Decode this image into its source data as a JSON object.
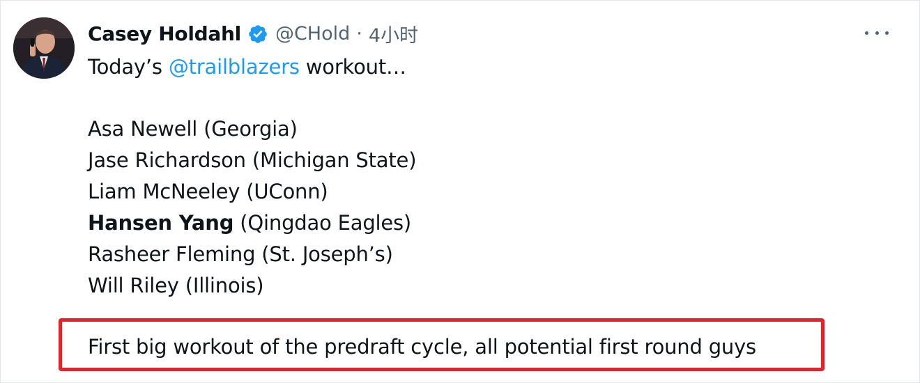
{
  "tweet": {
    "author_name": "Casey Holdahl",
    "handle": "@CHold",
    "separator": "·",
    "time": "4小时",
    "intro_prefix": "Today’s ",
    "mention": "@trailblazers",
    "intro_suffix": " workout…",
    "players": [
      {
        "name": "Asa Newell",
        "school": " (Georgia)"
      },
      {
        "name": "Jase Richardson",
        "school": " (Michigan State)"
      },
      {
        "name": "Liam McNeeley",
        "school": " (UConn)"
      },
      {
        "name": "Hansen Yang",
        "school": " (Qingdao Eagles)"
      },
      {
        "name": "Rasheer Fleming",
        "school": " (St. Joseph’s)"
      },
      {
        "name": "Will Riley",
        "school": " (Illinois)"
      }
    ],
    "closing_line": "First big workout of the predraft cycle, all potential first round guys"
  },
  "icons": {
    "avatar": "user-avatar",
    "verified": "verified-badge-icon",
    "more": "more-options-icon"
  },
  "colors": {
    "text": "#0f1419",
    "secondary": "#536471",
    "link": "#1d9bf0",
    "verified": "#1d9bf0",
    "highlight": "#e0262c"
  }
}
